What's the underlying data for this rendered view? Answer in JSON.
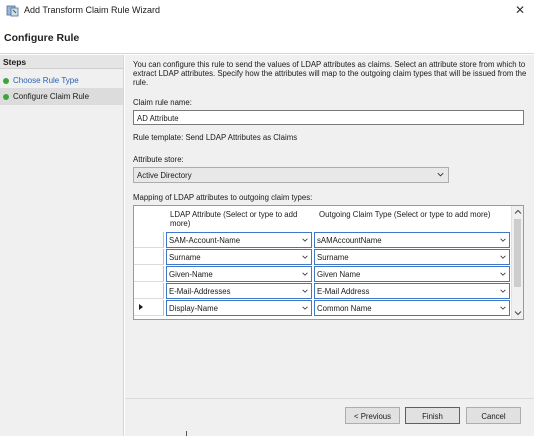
{
  "window": {
    "title": "Add Transform Claim Rule Wizard",
    "header": "Configure Rule"
  },
  "steps": {
    "heading": "Steps",
    "items": [
      {
        "label": "Choose Rule Type"
      },
      {
        "label": "Configure Claim Rule"
      }
    ]
  },
  "form": {
    "description": "You can configure this rule to send the values of LDAP attributes as claims. Select an attribute store from which to extract LDAP attributes. Specify how the attributes will map to the outgoing claim types that will be issued from the rule.",
    "rule_name_label": "Claim rule name:",
    "rule_name_value": "AD Attribute",
    "template_text": "Rule template: Send LDAP Attributes as Claims",
    "store_label": "Attribute store:",
    "store_value": "Active Directory",
    "mapping_label": "Mapping of LDAP attributes to outgoing claim types:"
  },
  "grid": {
    "col1": "LDAP Attribute (Select or type to add more)",
    "col2": "Outgoing Claim Type (Select or type to add more)",
    "rows": [
      {
        "ldap": "SAM-Account-Name",
        "claim": "sAMAccountName"
      },
      {
        "ldap": "Surname",
        "claim": "Surname"
      },
      {
        "ldap": "Given-Name",
        "claim": "Given Name"
      },
      {
        "ldap": "E-Mail-Addresses",
        "claim": "E-Mail Address"
      },
      {
        "ldap": "Display-Name",
        "claim": "Common Name"
      }
    ]
  },
  "buttons": {
    "previous": "< Previous",
    "finish": "Finish",
    "cancel": "Cancel"
  },
  "colors": {
    "accent": "#0078d7",
    "step_dot": "#3ea43e",
    "link": "#2a61b3",
    "cell_border": "#3f78c8"
  },
  "icons": {
    "app": "wizard-icon",
    "close": "close-icon",
    "dropdown": "chevron-down-icon"
  }
}
